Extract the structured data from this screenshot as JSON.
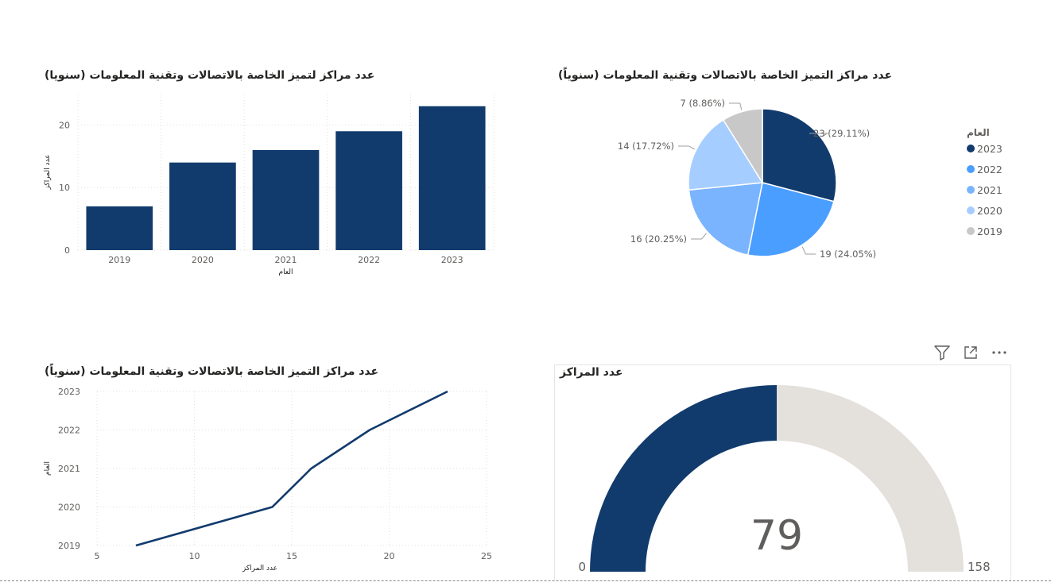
{
  "visuals": {
    "bar": {
      "title": "عدد مراكز لتميز الخاصة بالاتصالات وتقنية المعلومات (سنويا)",
      "xlabel": "العام",
      "ylabel": "عدد المراكز"
    },
    "pie": {
      "title": "عدد مراكز التميز الخاصة بالاتصالات وتقنية المعلومات (سنوياً)",
      "legend_title": "العام"
    },
    "line": {
      "title": "عدد مراكز التميز الخاصة بالاتصالات وتقنية المعلومات (سنوياً)",
      "xlabel": "عدد المراكز",
      "ylabel": "العام"
    },
    "gauge": {
      "title": "عدد المراكز",
      "value_label": "79",
      "min_label": "0",
      "max_label": "158",
      "icons": [
        "filter-icon",
        "focus-mode-icon",
        "more-options-icon"
      ]
    }
  },
  "colors": {
    "navy": "#123b6d",
    "blue": "#4a9eff",
    "mid_blue": "#7ab4ff",
    "light_blue": "#a6cdff",
    "gray": "#c8c8c8",
    "gauge_track": "#e4e0dc"
  },
  "chart_data": [
    {
      "type": "bar",
      "title": "عدد مراكز لتميز الخاصة بالاتصالات وتقنية المعلومات (سنويا)",
      "categories": [
        "2019",
        "2020",
        "2021",
        "2022",
        "2023"
      ],
      "values": [
        7,
        14,
        16,
        19,
        23
      ],
      "xlabel": "العام",
      "ylabel": "عدد المراكز",
      "ylim": [
        0,
        25
      ],
      "yticks": [
        "0",
        "10",
        "20"
      ],
      "grid": true
    },
    {
      "type": "pie",
      "title": "عدد مراكز التميز الخاصة بالاتصالات وتقنية المعلومات (سنوياً)",
      "slices": [
        {
          "label": "2023",
          "value": 23,
          "data_label": "23 (29.11%)",
          "color": "#123b6d"
        },
        {
          "label": "2022",
          "value": 19,
          "data_label": "19 (24.05%)",
          "color": "#4a9eff"
        },
        {
          "label": "2021",
          "value": 16,
          "data_label": "16 (20.25%)",
          "color": "#7ab4ff"
        },
        {
          "label": "2020",
          "value": 14,
          "data_label": "14 (17.72%)",
          "color": "#a6cdff"
        },
        {
          "label": "2019",
          "value": 7,
          "data_label": "7 (8.86%)",
          "color": "#c8c8c8"
        }
      ],
      "legend_title": "العام",
      "legend": "right"
    },
    {
      "type": "line",
      "title": "عدد مراكز التميز الخاصة بالاتصالات وتقنية المعلومات (سنوياً)",
      "x": [
        7,
        14,
        16,
        19,
        23
      ],
      "y": [
        2019,
        2020,
        2021,
        2022,
        2023
      ],
      "xlabel": "عدد المراكز",
      "ylabel": "العام",
      "xlim": [
        5,
        25
      ],
      "ylim": [
        2019,
        2023
      ],
      "xticks": [
        "5",
        "10",
        "15",
        "20",
        "25"
      ],
      "yticks": [
        "2019",
        "2020",
        "2021",
        "2022",
        "2023"
      ],
      "grid": true
    },
    {
      "type": "gauge",
      "title": "عدد المراكز",
      "value": 79,
      "min": 0,
      "max": 158
    }
  ]
}
